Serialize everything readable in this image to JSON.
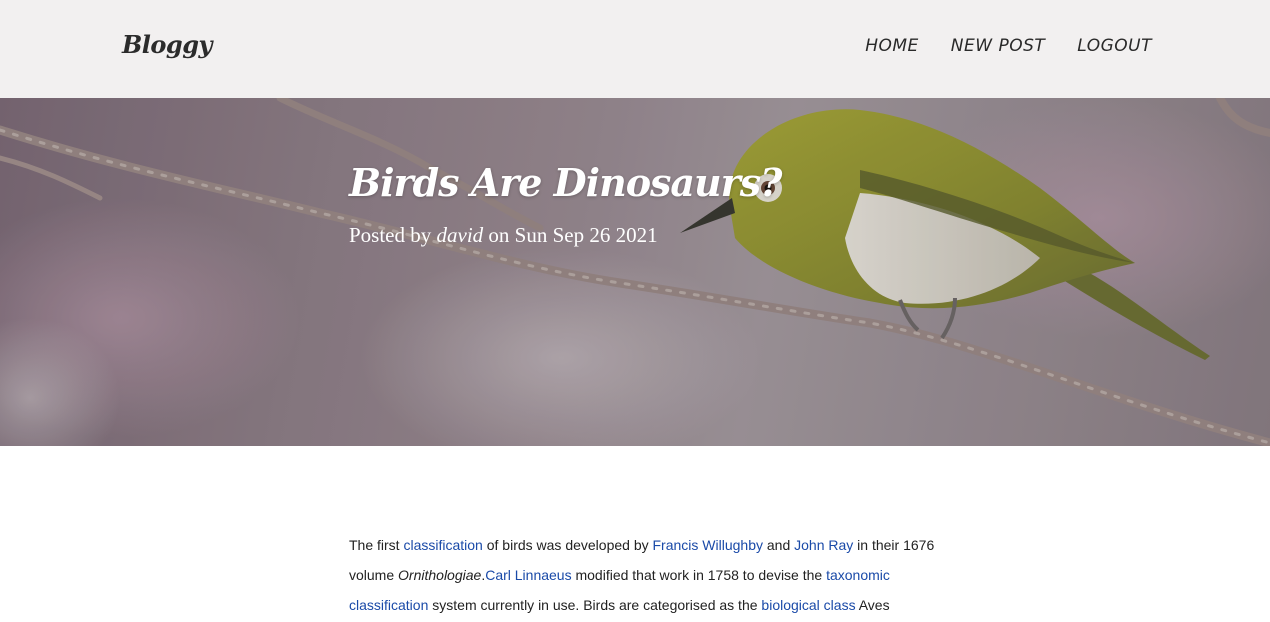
{
  "header": {
    "brand": "Bloggy",
    "nav": [
      {
        "label": "HOME"
      },
      {
        "label": "NEW POST"
      },
      {
        "label": "LOGOUT"
      }
    ]
  },
  "hero": {
    "image_subject": "bird-on-branch",
    "title": "Birds Are Dinosaurs?",
    "posted_prefix": "Posted by",
    "author": "david",
    "date_prefix": "on",
    "date": "Sun Sep 26 2021"
  },
  "article": {
    "line1": {
      "t1": "The first ",
      "link1": "classification",
      "t2": " of birds was developed by ",
      "link2": "Francis Willughby",
      "t3": " and ",
      "link3": "John Ray",
      "t4": " in their 1676"
    },
    "line2": {
      "t1": "volume ",
      "em1": "Ornithologiae",
      "t2": ".",
      "link1": "Carl Linnaeus",
      "t3": " modified that work in 1758 to devise the ",
      "link2": "taxonomic"
    },
    "line3": {
      "link1": "classification",
      "t1": " system currently in use. Birds are categorised as the ",
      "link2": "biological class",
      "t2": " Aves"
    }
  },
  "colors": {
    "header_bg": "#f2f0f0",
    "link": "#1a4aa8",
    "hero_text": "#ffffff"
  }
}
